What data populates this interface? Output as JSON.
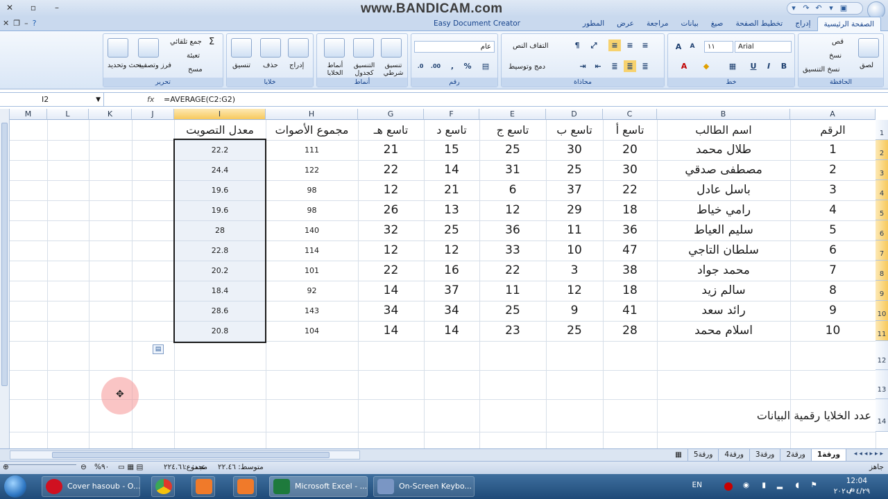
{
  "window": {
    "watermark": "www.BANDICAM.com",
    "addin_tab": "Easy Document Creator"
  },
  "tabs": [
    "الصفحة الرئيسية",
    "إدراج",
    "تخطيط الصفحة",
    "صيغ",
    "بيانات",
    "مراجعة",
    "عرض",
    "المطور"
  ],
  "ribbon": {
    "clipboard": {
      "label": "الحافظة",
      "paste": "لصق",
      "cut": "قص",
      "copy": "نسخ",
      "format_painter": "نسخ التنسيق"
    },
    "font": {
      "label": "خط",
      "name": "Arial",
      "size": "١١"
    },
    "alignment": {
      "label": "محاذاة",
      "wrap": "التفاف النص",
      "merge": "دمج وتوسيط"
    },
    "number": {
      "label": "رقم",
      "format": "عام",
      "percent": "%"
    },
    "styles": {
      "label": "أنماط",
      "conditional": "تنسيق شرطي",
      "table": "التنسيق كجدول",
      "cell": "أنماط الخلايا"
    },
    "cells": {
      "label": "خلايا",
      "insert": "إدراج",
      "delete": "حذف",
      "format": "تنسيق"
    },
    "editing": {
      "label": "تحرير",
      "autosum": "جمع تلقائي",
      "fill": "تعبئة",
      "clear": "مسح",
      "sort": "فرز وتصفية",
      "find": "بحث وتحديد"
    }
  },
  "formula_bar": {
    "name_box": "I2",
    "fx": "fx",
    "formula": "=AVERAGE(C2:G2)"
  },
  "columns": [
    "M",
    "L",
    "K",
    "J",
    "I",
    "H",
    "G",
    "F",
    "E",
    "D",
    "C",
    "B",
    "A"
  ],
  "rows": [
    "1",
    "2",
    "3",
    "4",
    "5",
    "6",
    "7",
    "8",
    "9",
    "10",
    "11",
    "12",
    "13",
    "14"
  ],
  "headers": {
    "A": "الرقم",
    "B": "اسم الطالب",
    "C": "تاسع أ",
    "D": "تاسع ب",
    "E": "تاسع ج",
    "F": "تاسع د",
    "G": "تاسع هـ",
    "H": "مجموع الأصوات",
    "I": "معدل التصويت"
  },
  "table": [
    {
      "A": "1",
      "B": "طلال محمد",
      "C": "20",
      "D": "30",
      "E": "25",
      "F": "15",
      "G": "21",
      "H": "111",
      "I": "22.2"
    },
    {
      "A": "2",
      "B": "مصطفى صدقي",
      "C": "30",
      "D": "25",
      "E": "31",
      "F": "14",
      "G": "22",
      "H": "122",
      "I": "24.4"
    },
    {
      "A": "3",
      "B": "باسل عادل",
      "C": "22",
      "D": "37",
      "E": "6",
      "F": "21",
      "G": "12",
      "H": "98",
      "I": "19.6"
    },
    {
      "A": "4",
      "B": "رامي خياط",
      "C": "18",
      "D": "29",
      "E": "12",
      "F": "13",
      "G": "26",
      "H": "98",
      "I": "19.6"
    },
    {
      "A": "5",
      "B": "سليم العياط",
      "C": "36",
      "D": "11",
      "E": "36",
      "F": "25",
      "G": "32",
      "H": "140",
      "I": "28"
    },
    {
      "A": "6",
      "B": "سلطان التاجي",
      "C": "47",
      "D": "10",
      "E": "33",
      "F": "12",
      "G": "12",
      "H": "114",
      "I": "22.8"
    },
    {
      "A": "7",
      "B": "محمد جواد",
      "C": "38",
      "D": "3",
      "E": "22",
      "F": "16",
      "G": "22",
      "H": "101",
      "I": "20.2"
    },
    {
      "A": "8",
      "B": "سالم زيد",
      "C": "18",
      "D": "12",
      "E": "11",
      "F": "37",
      "G": "14",
      "H": "92",
      "I": "18.4"
    },
    {
      "A": "9",
      "B": "رائد سعد",
      "C": "41",
      "D": "9",
      "E": "25",
      "F": "34",
      "G": "34",
      "H": "143",
      "I": "28.6"
    },
    {
      "A": "10",
      "B": "اسلام محمد",
      "C": "28",
      "D": "25",
      "E": "23",
      "F": "14",
      "G": "14",
      "H": "104",
      "I": "20.8"
    }
  ],
  "note_row14": "عدد الخلايا رقمية البيانات",
  "sheets": [
    "ورقة1",
    "ورقة2",
    "ورقة3",
    "ورقة4",
    "ورقة5"
  ],
  "status": {
    "ready": "جاهز",
    "average": "متوسط: ٢٢.٤٦",
    "count": "عدد: ١٠",
    "sum": "مجموع: ٢٢٤.٦",
    "zoom": "%٩٠"
  },
  "taskbar": {
    "items": [
      "Cover hasoub - O...",
      "Microsoft Excel - ...",
      "On-Screen Keybo..."
    ],
    "lang": "EN",
    "time": "12:04 ص",
    "date": "٢٠٢٠/٠٤/٢٩"
  }
}
